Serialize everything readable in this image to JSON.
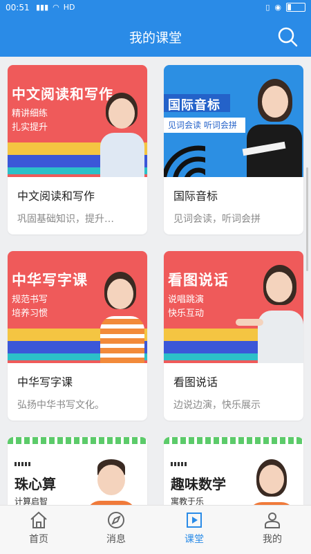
{
  "statusbar": {
    "time": "00:51",
    "net": "HD"
  },
  "header": {
    "title": "我的课堂"
  },
  "courses": [
    {
      "title": "中文阅读和写作",
      "desc": "巩固基础知识，提升…",
      "banner_title": "中文阅读和写作",
      "banner_sub1": "精讲细练",
      "banner_sub2": "扎实提升"
    },
    {
      "title": "国际音标",
      "desc": "见词会读，听词会拼",
      "banner_title": "国际音标",
      "banner_sub1": "见词会读 听词会拼"
    },
    {
      "title": "中华写字课",
      "desc": "弘扬中华书写文化。",
      "banner_title": "中华写字课",
      "banner_sub1": "规范书写",
      "banner_sub2": "培养习惯"
    },
    {
      "title": "看图说话",
      "desc": "边说边演，快乐展示",
      "banner_title": "看图说话",
      "banner_sub1": "说唱跳演",
      "banner_sub2": "快乐互动"
    },
    {
      "banner_title": "珠心算",
      "banner_sub1": "计算启智"
    },
    {
      "banner_title": "趣味数学",
      "banner_sub1": "寓教于乐"
    }
  ],
  "tabs": [
    {
      "label": "首页"
    },
    {
      "label": "消息"
    },
    {
      "label": "课堂"
    },
    {
      "label": "我的"
    }
  ],
  "colors": {
    "primary": "#2a8be7",
    "banner_red": "#ef5a5a",
    "banner_blue": "#2c8fe3"
  }
}
